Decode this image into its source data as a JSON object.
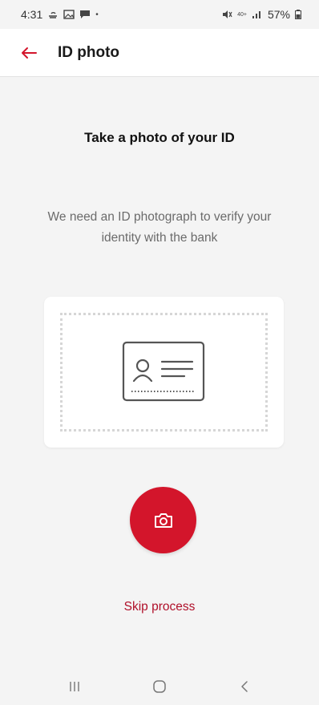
{
  "status_bar": {
    "time": "4:31",
    "network_small": "40+",
    "battery": "57%"
  },
  "app_bar": {
    "title": "ID photo"
  },
  "main": {
    "heading": "Take a photo of your ID",
    "description": "We need an ID photograph to verify your identity with the bank",
    "skip_label": "Skip process"
  },
  "colors": {
    "accent": "#d3152b",
    "skip_text": "#b0102a",
    "muted_text": "#6b6b6b",
    "background": "#f4f4f4"
  },
  "icons": {
    "back": "arrow-left-icon",
    "camera": "camera-icon",
    "id_card": "id-card-icon"
  }
}
